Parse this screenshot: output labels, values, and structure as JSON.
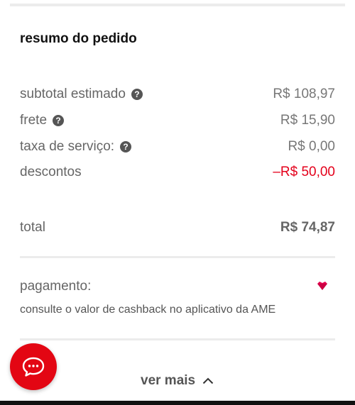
{
  "summary": {
    "title": "resumo do pedido",
    "rows": [
      {
        "label": "subtotal estimado",
        "value": "R$ 108,97",
        "help": true
      },
      {
        "label": "frete",
        "value": "R$ 15,90",
        "help": true
      },
      {
        "label": "taxa de serviço:",
        "value": "R$ 0,00",
        "help": true
      },
      {
        "label": "descontos",
        "value": "–R$ 50,00",
        "help": false
      }
    ],
    "total": {
      "label": "total",
      "value": "R$ 74,87"
    }
  },
  "payment": {
    "label": "pagamento:",
    "cashback_text": "consulte o valor de cashback no aplicativo da AME",
    "icon": "ame-heart-icon"
  },
  "footer": {
    "see_more_label": "ver mais",
    "chat_icon": "chat-bubble-icon"
  },
  "colors": {
    "accent": "#e30613",
    "discount": "#e4001b",
    "ame_pink": "#e4004d"
  }
}
